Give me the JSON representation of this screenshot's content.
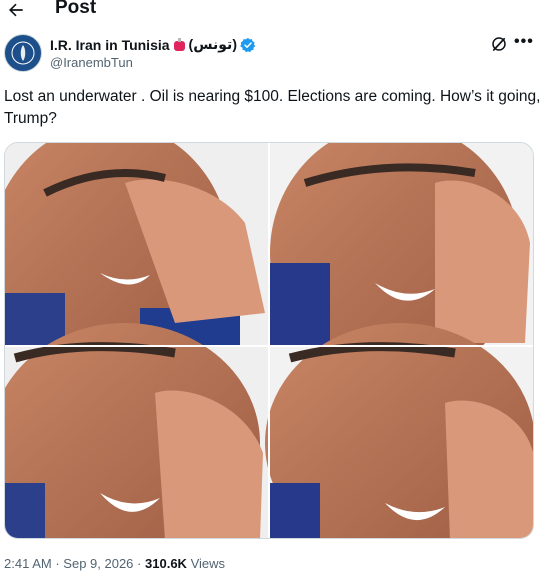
{
  "header": {
    "title": "Post"
  },
  "author": {
    "display_name": "I.R. Iran in Tunisia",
    "arabic_name": "(تونس)",
    "handle": "@IranembTun"
  },
  "post": {
    "text": "Lost an underwater . Oil is nearing $100. Elections are coming. How’s it going, Trump?"
  },
  "meta": {
    "time": "2:41 AM",
    "date": "Sep 9, 2026",
    "views_count": "310.6K",
    "views_label": "Views",
    "separator": "·"
  },
  "icons": [
    "back-arrow-icon",
    "flag-icon",
    "verified-badge-icon",
    "grok-icon",
    "more-icon"
  ],
  "colors": {
    "verified": "#1d9bf0",
    "muted_text": "#536471",
    "flag": "#e0245e"
  }
}
